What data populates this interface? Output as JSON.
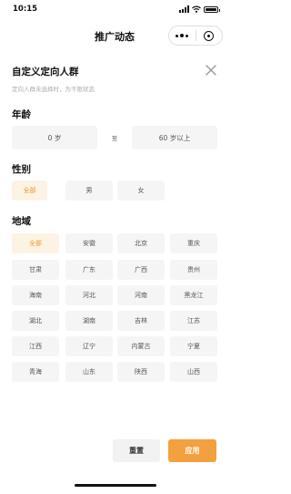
{
  "status_bar": {
    "time": "10:15"
  },
  "nav": {
    "title": "推广动态"
  },
  "panel": {
    "title": "自定义定向人群",
    "subtitle": "定向人群未选择时，为不限状态"
  },
  "age": {
    "label": "年龄",
    "min_value": "0 岁",
    "separator": "至",
    "max_value": "60 岁以上"
  },
  "gender": {
    "label": "性别",
    "options": [
      "全部",
      "男",
      "女"
    ],
    "selected": "全部"
  },
  "region": {
    "label": "地域",
    "selected": "全部",
    "options": [
      "全部",
      "安徽",
      "北京",
      "重庆",
      "甘肃",
      "广东",
      "广西",
      "贵州",
      "海南",
      "河北",
      "河南",
      "黑龙江",
      "湖北",
      "湖南",
      "吉林",
      "江苏",
      "江西",
      "辽宁",
      "内蒙古",
      "宁夏",
      "青海",
      "山东",
      "陕西",
      "山西"
    ]
  },
  "actions": {
    "reset_label": "重置",
    "apply_label": "应用"
  },
  "colors": {
    "accent": "#f3a03f",
    "accent_soft": "#fdf3e4",
    "chip_bg": "#f5f5f5"
  }
}
